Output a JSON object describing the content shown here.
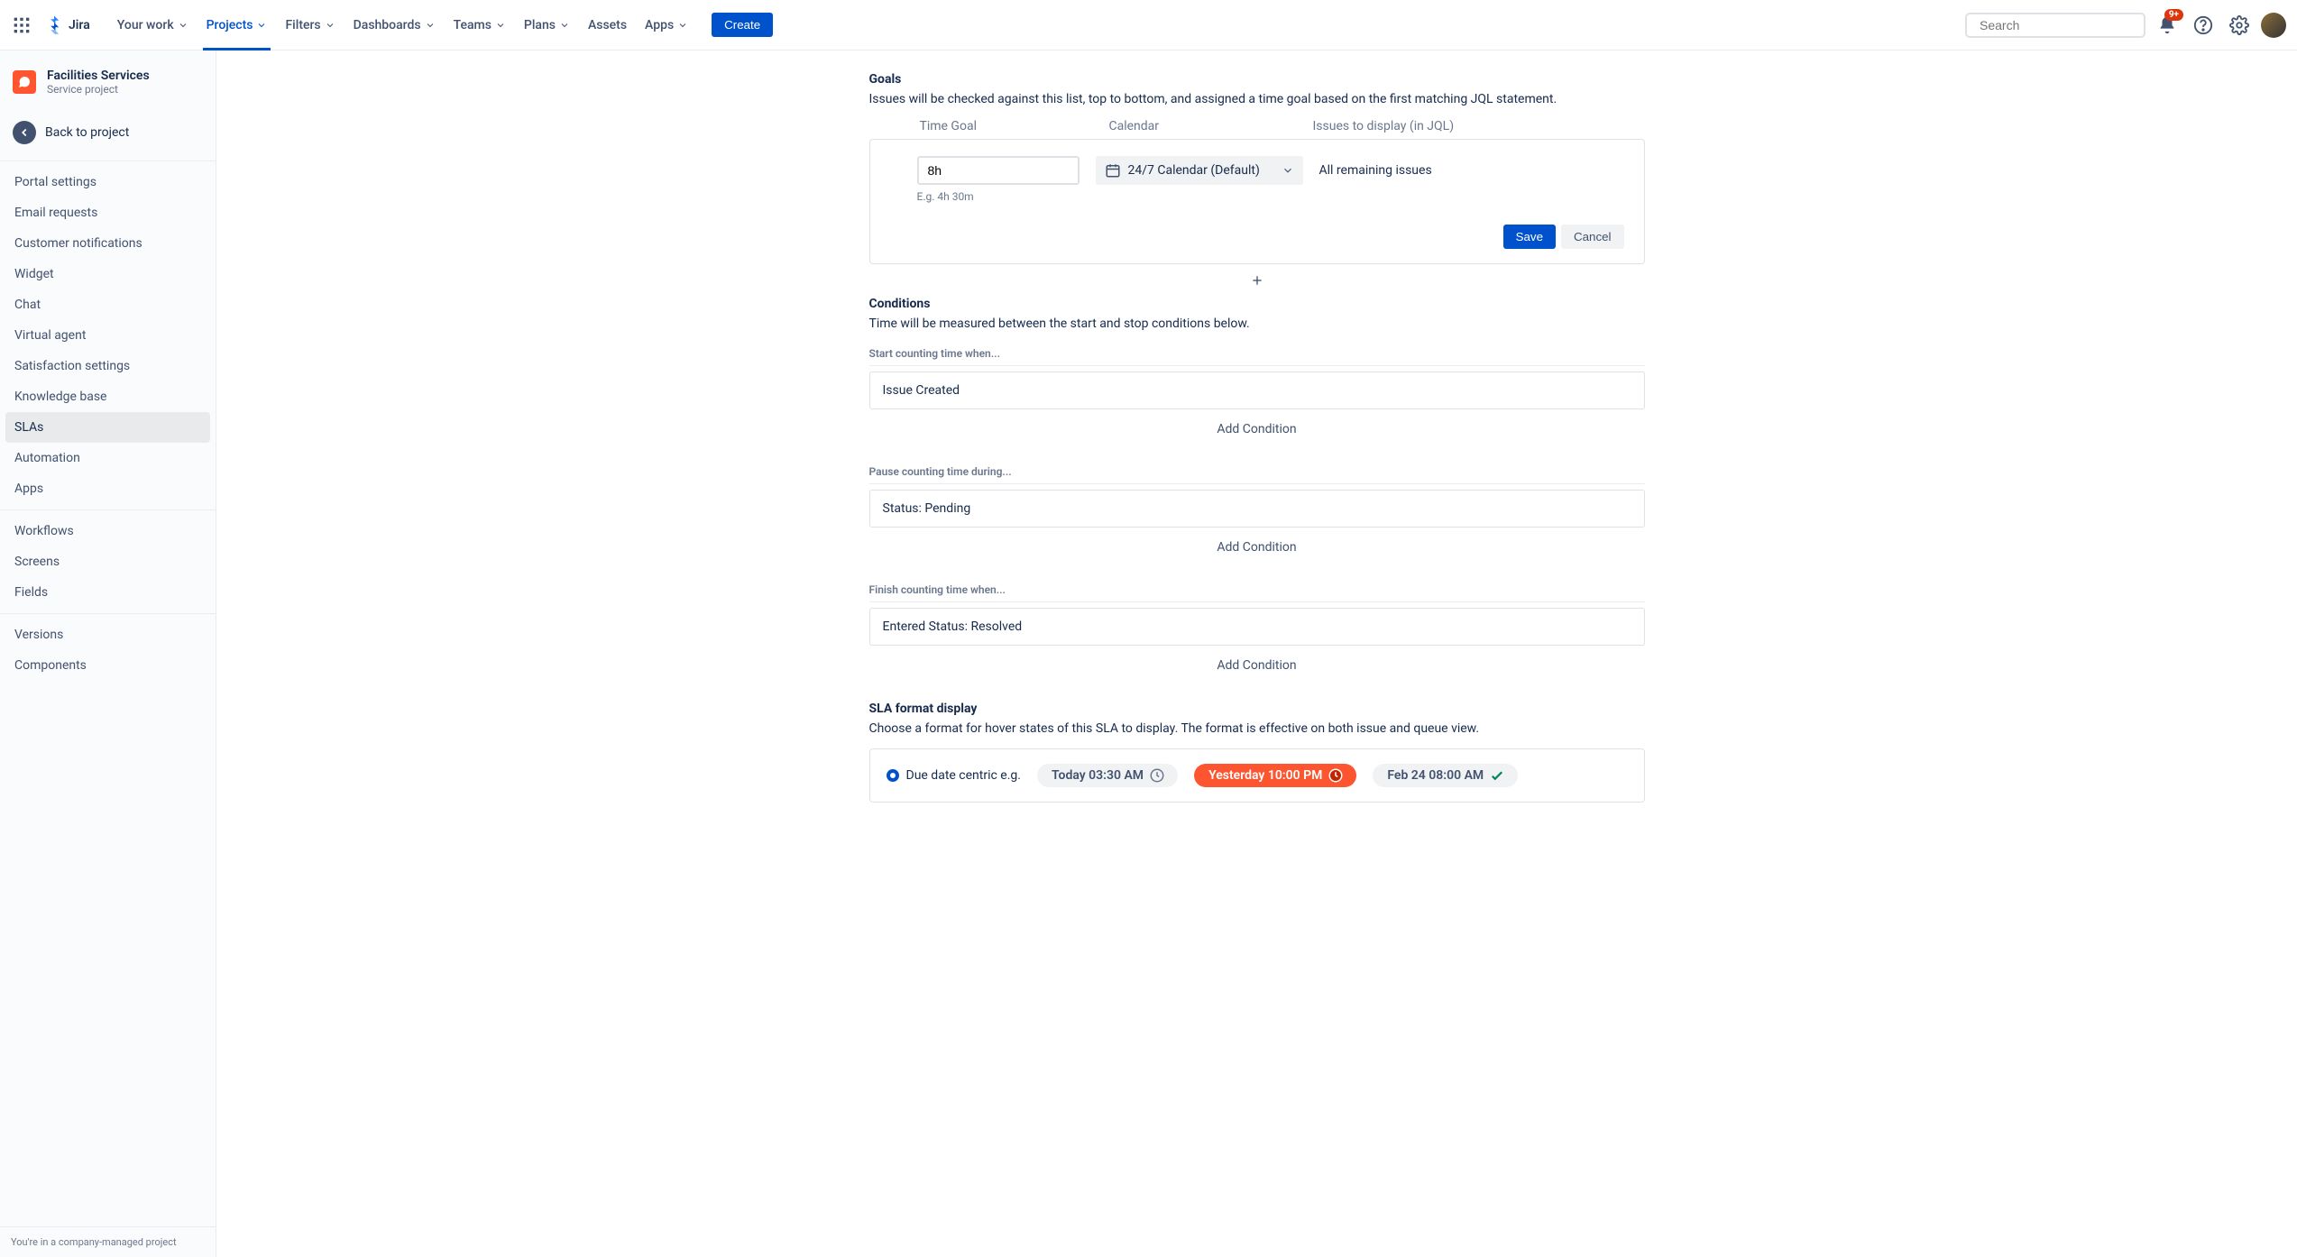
{
  "topnav": {
    "logo_text": "Jira",
    "items": [
      {
        "label": "Your work",
        "dropdown": true
      },
      {
        "label": "Projects",
        "dropdown": true,
        "active": true
      },
      {
        "label": "Filters",
        "dropdown": true
      },
      {
        "label": "Dashboards",
        "dropdown": true
      },
      {
        "label": "Teams",
        "dropdown": true
      },
      {
        "label": "Plans",
        "dropdown": true
      },
      {
        "label": "Assets",
        "dropdown": false
      },
      {
        "label": "Apps",
        "dropdown": true
      }
    ],
    "create": "Create",
    "search_placeholder": "Search",
    "notif_badge": "9+"
  },
  "sidebar": {
    "project_name": "Facilities Services",
    "project_type": "Service project",
    "back": "Back to project",
    "groups": [
      [
        "Portal settings",
        "Email requests",
        "Customer notifications",
        "Widget",
        "Chat",
        "Virtual agent",
        "Satisfaction settings",
        "Knowledge base",
        "SLAs",
        "Automation",
        "Apps"
      ],
      [
        "Workflows",
        "Screens",
        "Fields"
      ],
      [
        "Versions",
        "Components"
      ]
    ],
    "active": "SLAs",
    "footer": "You're in a company-managed project"
  },
  "goals": {
    "title": "Goals",
    "desc": "Issues will be checked against this list, top to bottom, and assigned a time goal based on the first matching JQL statement.",
    "headers": {
      "time": "Time Goal",
      "cal": "Calendar",
      "issues": "Issues to display (in JQL)"
    },
    "row": {
      "time_value": "8h",
      "eg": "E.g. 4h 30m",
      "calendar": "24/7 Calendar (Default)",
      "issues": "All remaining issues"
    },
    "save": "Save",
    "cancel": "Cancel"
  },
  "conditions": {
    "title": "Conditions",
    "desc": "Time will be measured between the start and stop conditions below.",
    "start_label": "Start counting time when...",
    "start_value": "Issue Created",
    "pause_label": "Pause counting time during...",
    "pause_value": "Status: Pending",
    "finish_label": "Finish counting time when...",
    "finish_value": "Entered Status: Resolved",
    "add": "Add Condition"
  },
  "sla_format": {
    "title": "SLA format display",
    "desc": "Choose a format for hover states of this SLA to display. The format is effective on both issue and queue view.",
    "radio_label": "Due date centric e.g.",
    "examples": {
      "today": "Today 03:30 AM",
      "yesterday": "Yesterday 10:00 PM",
      "feb": "Feb 24 08:00 AM"
    }
  }
}
